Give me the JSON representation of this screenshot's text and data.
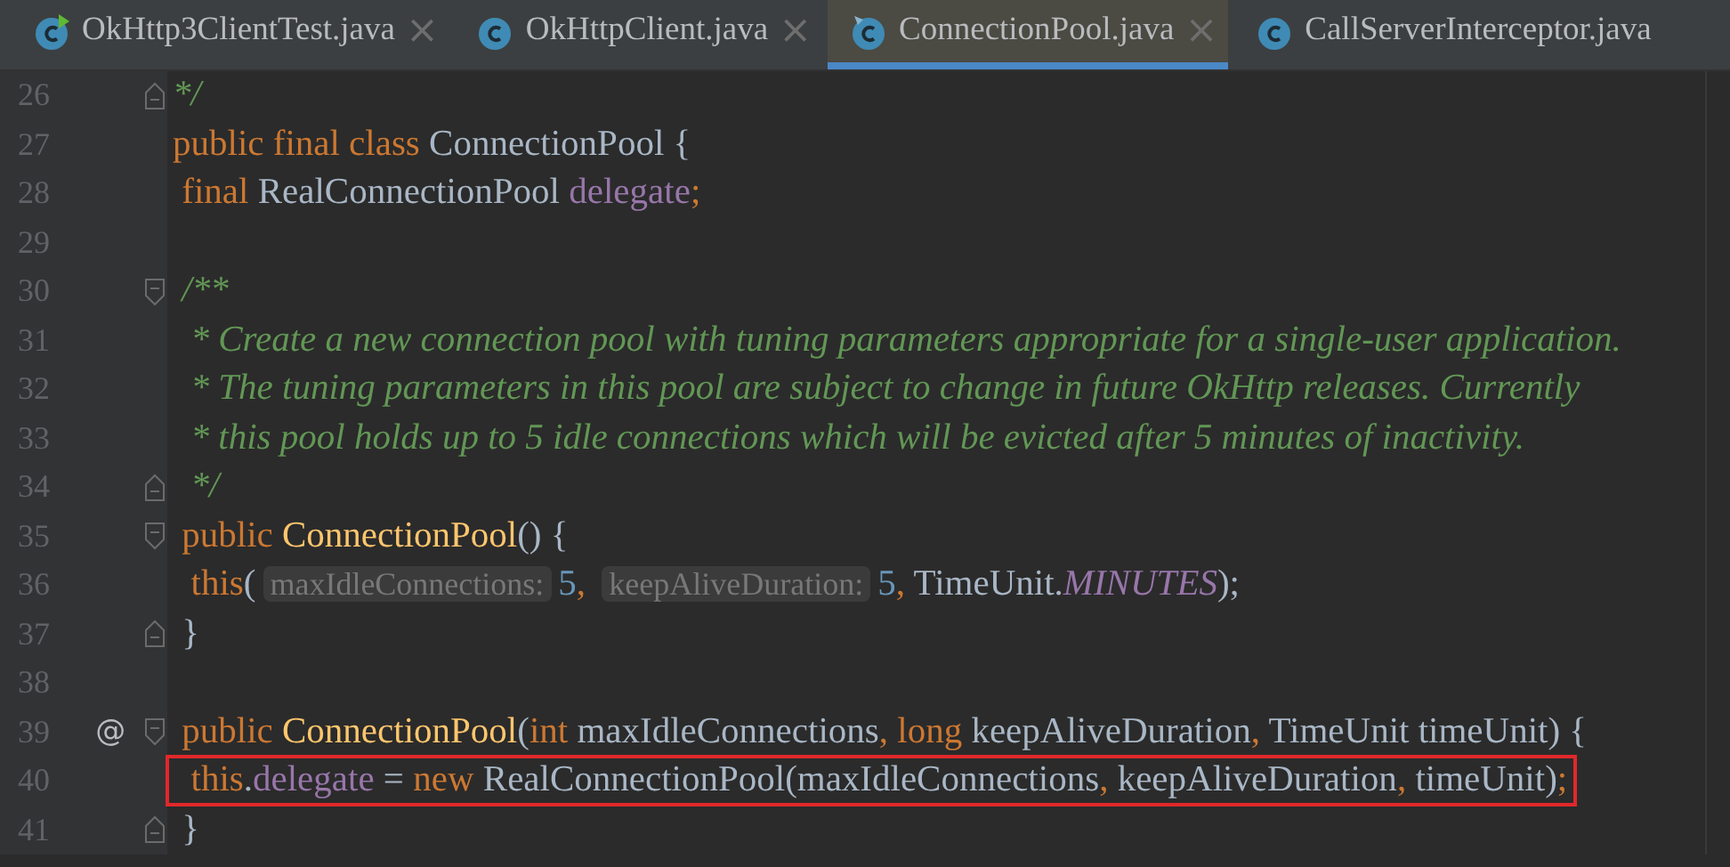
{
  "tabs": [
    {
      "label": "OkHttp3ClientTest.java",
      "kind": "test",
      "selected": false,
      "close": "×"
    },
    {
      "label": "OkHttpClient.java",
      "kind": "class",
      "selected": false,
      "close": "×"
    },
    {
      "label": "ConnectionPool.java",
      "kind": "class",
      "selected": true,
      "close": "×"
    },
    {
      "label": "CallServerInterceptor.java",
      "kind": "class",
      "selected": false
    }
  ],
  "lines": [
    {
      "number": "26",
      "kind": "closer",
      "tokens": [
        {
          "kind": "comment",
          "text": "*/"
        }
      ]
    },
    {
      "number": "27",
      "kind": "plain",
      "tokens": [
        {
          "kind": "keyword",
          "text": "public final class "
        },
        {
          "kind": "plain",
          "text": "ConnectionPool {"
        }
      ]
    },
    {
      "number": "28",
      "kind": "plain",
      "tokens": [
        {
          "kind": "keyword",
          "text": " final "
        },
        {
          "kind": "plain",
          "text": "RealConnectionPool "
        },
        {
          "kind": "field",
          "text": "delegate"
        },
        {
          "kind": "keyword",
          "text": ";"
        }
      ]
    },
    {
      "number": "29",
      "kind": "plain"
    },
    {
      "number": "30",
      "kind": "opener",
      "tokens": [
        {
          "kind": "comment",
          "text": " /**"
        }
      ]
    },
    {
      "number": "31",
      "kind": "plain",
      "tokens": [
        {
          "kind": "comment",
          "text": "  * Create a new connection pool with tuning parameters appropriate for a single-user application."
        }
      ]
    },
    {
      "number": "32",
      "kind": "plain",
      "tokens": [
        {
          "kind": "comment",
          "text": "  * The tuning parameters in this pool are subject to change in future OkHttp releases. Currently"
        }
      ]
    },
    {
      "number": "33",
      "kind": "plain",
      "tokens": [
        {
          "kind": "comment",
          "text": "  * this pool holds up to 5 idle connections which will be evicted after 5 minutes of inactivity."
        }
      ]
    },
    {
      "number": "34",
      "kind": "closer",
      "tokens": [
        {
          "kind": "comment",
          "text": "  */"
        }
      ]
    },
    {
      "number": "35",
      "kind": "opener",
      "tokens": [
        {
          "kind": "keyword",
          "text": " public "
        },
        {
          "kind": "method",
          "text": "ConnectionPool"
        },
        {
          "kind": "plain",
          "text": "() {"
        }
      ]
    },
    {
      "number": "36",
      "kind": "plain",
      "tokens": [
        {
          "kind": "keyword",
          "text": "  this"
        },
        {
          "kind": "plain",
          "text": "("
        },
        {
          "kind": "hint",
          "text": "maxIdleConnections:"
        },
        {
          "kind": "number",
          "text": "5"
        },
        {
          "kind": "keyword",
          "text": ", "
        },
        {
          "kind": "hint",
          "text": "keepAliveDuration:"
        },
        {
          "kind": "number",
          "text": "5"
        },
        {
          "kind": "keyword",
          "text": ", "
        },
        {
          "kind": "plain",
          "text": "TimeUnit."
        },
        {
          "kind": "constant",
          "text": "MINUTES"
        },
        {
          "kind": "plain",
          "text": ");"
        }
      ]
    },
    {
      "number": "37",
      "kind": "closer",
      "tokens": [
        {
          "kind": "plain",
          "text": " }"
        }
      ]
    },
    {
      "number": "38",
      "kind": "plain"
    },
    {
      "number": "39",
      "kind": "opener",
      "marker": "@",
      "tokens": [
        {
          "kind": "keyword",
          "text": " public "
        },
        {
          "kind": "method",
          "text": "ConnectionPool"
        },
        {
          "kind": "plain",
          "text": "("
        },
        {
          "kind": "keyword",
          "text": "int "
        },
        {
          "kind": "plain",
          "text": "maxIdleConnections"
        },
        {
          "kind": "keyword",
          "text": ", long "
        },
        {
          "kind": "plain",
          "text": "keepAliveDuration"
        },
        {
          "kind": "keyword",
          "text": ", "
        },
        {
          "kind": "plain",
          "text": "TimeUnit timeUnit) {"
        }
      ]
    },
    {
      "number": "40",
      "kind": "plain",
      "highlighted": true,
      "tokens": [
        {
          "kind": "keyword",
          "text": "  this"
        },
        {
          "kind": "plain",
          "text": "."
        },
        {
          "kind": "field",
          "text": "delegate"
        },
        {
          "kind": "plain",
          "text": " = "
        },
        {
          "kind": "keyword",
          "text": "new "
        },
        {
          "kind": "plain",
          "text": "RealConnectionPool(maxIdleConnections"
        },
        {
          "kind": "keyword",
          "text": ", "
        },
        {
          "kind": "plain",
          "text": "keepAliveDuration"
        },
        {
          "kind": "keyword",
          "text": ", "
        },
        {
          "kind": "plain",
          "text": "timeUnit)"
        },
        {
          "kind": "keyword",
          "text": ";"
        }
      ]
    },
    {
      "number": "41",
      "kind": "closer",
      "tokens": [
        {
          "kind": "plain",
          "text": " }"
        }
      ]
    }
  ]
}
